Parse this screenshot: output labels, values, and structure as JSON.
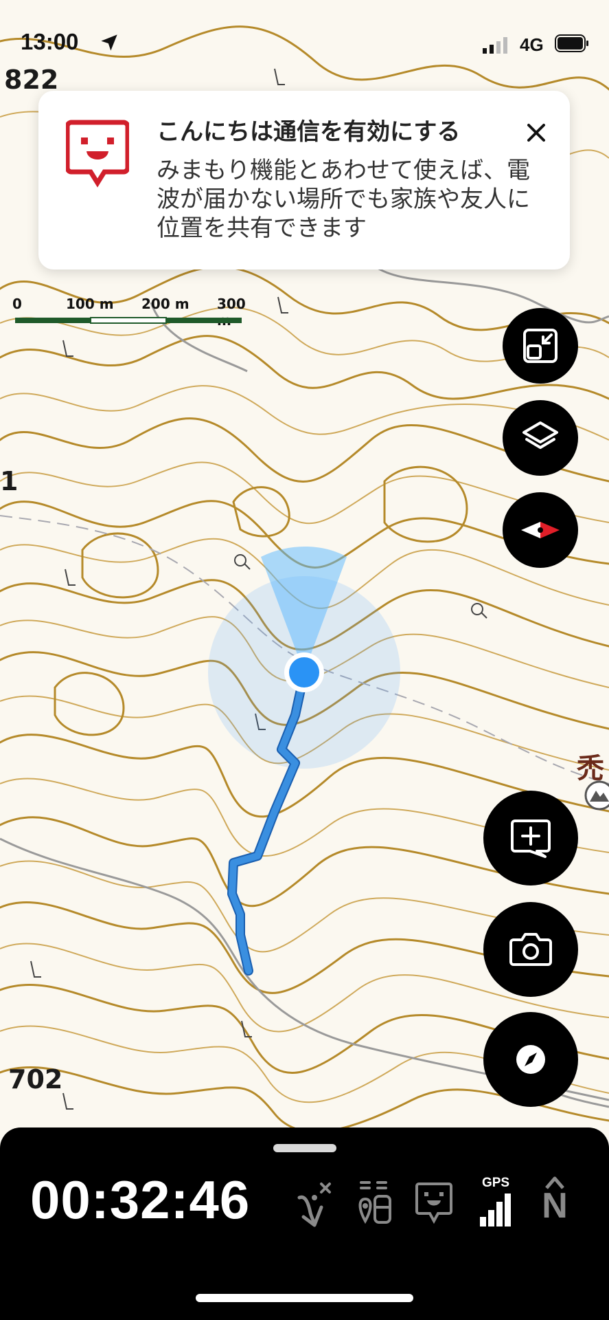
{
  "status_bar": {
    "time": "13:00",
    "network": "4G"
  },
  "map": {
    "elevation_labels": [
      "822",
      "1",
      "702"
    ],
    "poi_label": "禿",
    "colors": {
      "background": "#fbf8f0",
      "contour": "#b58a2a",
      "contour_light": "#cfa95a",
      "track": "#3a8fe0",
      "location": "#2a93f5",
      "road": "#9a9a9a"
    }
  },
  "banner": {
    "title": "こんにちは通信を有効にする",
    "body": "みまもり機能とあわせて使えば、電波が届かない場所でも家族や友人に位置を共有できます",
    "logo": "konnichiwa-logo",
    "close_icon": "close-icon"
  },
  "scale_bar": {
    "labels": [
      "0",
      "100 m",
      "200 m",
      "300 m"
    ]
  },
  "buttons": {
    "fit_icon": "fit-screen-icon",
    "layers_icon": "layers-icon",
    "compass_icon": "compass-orientation-icon",
    "add_note_icon": "add-note-icon",
    "camera_icon": "camera-icon",
    "navigate_icon": "navigation-compass-icon"
  },
  "bottom_panel": {
    "elapsed_time": "00:32:46",
    "gps_label": "GPS",
    "north_label": "N",
    "icons": [
      "route-off-icon",
      "pins-icon",
      "konnichiwa-icon",
      "gps-signal-icon",
      "north-icon"
    ]
  }
}
